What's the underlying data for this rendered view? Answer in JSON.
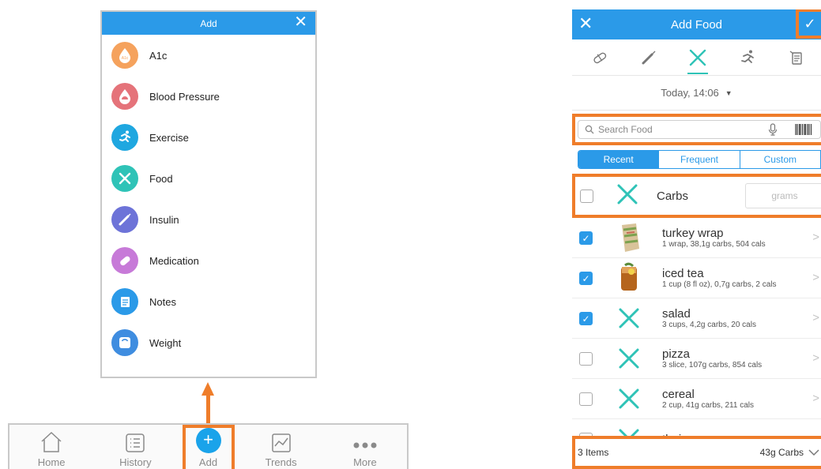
{
  "add_menu": {
    "title": "Add",
    "close_glyph": "✕",
    "items": [
      {
        "label": "A1c",
        "icon": "a1c-drop-icon",
        "color": "#f5a25d"
      },
      {
        "label": "Blood Pressure",
        "icon": "blood-pressure-icon",
        "color": "#e5737a"
      },
      {
        "label": "Exercise",
        "icon": "runner-icon",
        "color": "#1fa7e0"
      },
      {
        "label": "Food",
        "icon": "fork-knife-icon",
        "color": "#2fc3b7"
      },
      {
        "label": "Insulin",
        "icon": "syringe-icon",
        "color": "#6d73d8"
      },
      {
        "label": "Medication",
        "icon": "pill-icon",
        "color": "#c77ad8"
      },
      {
        "label": "Notes",
        "icon": "notes-icon",
        "color": "#2b9ae8"
      },
      {
        "label": "Weight",
        "icon": "scale-icon",
        "color": "#3f8de0"
      }
    ]
  },
  "tabbar": {
    "tabs": [
      {
        "label": "Home",
        "icon": "home-icon"
      },
      {
        "label": "History",
        "icon": "history-list-icon"
      },
      {
        "label": "Add",
        "icon": "plus-icon"
      },
      {
        "label": "Trends",
        "icon": "trends-chart-icon"
      },
      {
        "label": "More",
        "icon": "more-dots-icon"
      }
    ],
    "add_glyph": "+"
  },
  "add_food": {
    "title": "Add Food",
    "close_glyph": "✕",
    "confirm_glyph": "✓",
    "type_icons": [
      "pill-icon",
      "syringe-icon",
      "fork-knife-icon",
      "runner-icon",
      "notes-icon"
    ],
    "date": "Today, 14:06",
    "search_placeholder": "Search Food",
    "segments": [
      "Recent",
      "Frequent",
      "Custom"
    ],
    "carbs_row": {
      "label": "Carbs",
      "placeholder": "grams"
    },
    "items": [
      {
        "name": "turkey wrap",
        "desc": "1 wrap, 38,1g carbs, 504 cals",
        "checked": true,
        "thumb": "wrap"
      },
      {
        "name": "iced tea",
        "desc": "1 cup (8 fl oz), 0,7g carbs, 2 cals",
        "checked": true,
        "thumb": "tea"
      },
      {
        "name": "salad",
        "desc": "3 cups, 4,2g carbs, 20 cals",
        "checked": true,
        "thumb": "fork"
      },
      {
        "name": "pizza",
        "desc": "3 slice, 107g carbs, 854 cals",
        "checked": false,
        "thumb": "fork"
      },
      {
        "name": "cereal",
        "desc": "2 cup, 41g carbs, 211 cals",
        "checked": false,
        "thumb": "fork"
      },
      {
        "name": "thai curry",
        "desc": "",
        "checked": false,
        "thumb": "fork"
      }
    ],
    "footer": {
      "count": "3 Items",
      "total": "43g Carbs"
    },
    "accent": "#2b9ae8",
    "highlight": "#ef7d2a"
  }
}
